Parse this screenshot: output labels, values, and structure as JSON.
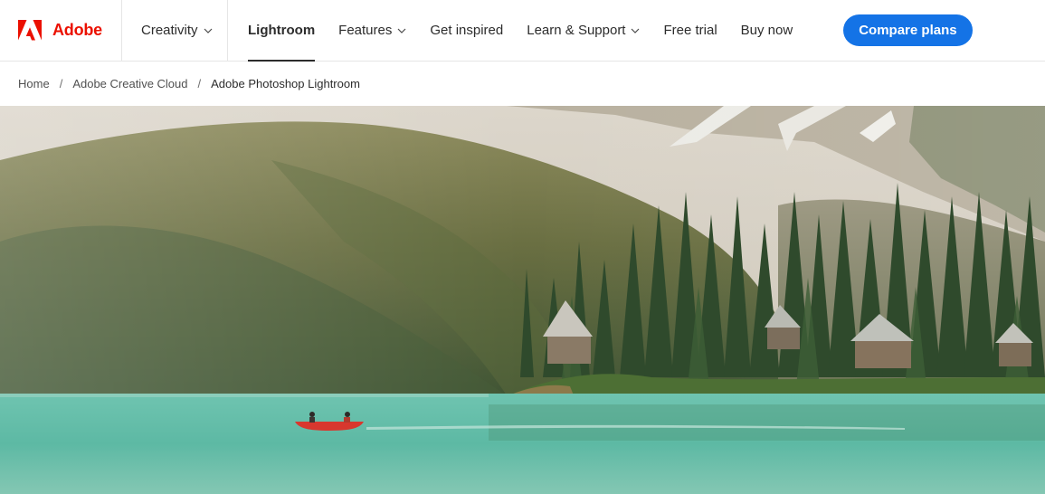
{
  "brand": {
    "name": "Adobe",
    "logo_icon": "adobe-logo-icon",
    "color": "#eb1000"
  },
  "nav": {
    "creativity": {
      "label": "Creativity",
      "icon": "chevron-down-icon"
    },
    "product": "Lightroom",
    "features": {
      "label": "Features",
      "icon": "chevron-down-icon"
    },
    "get_inspired": "Get inspired",
    "learn_support": {
      "label": "Learn & Support",
      "icon": "chevron-down-icon"
    },
    "free_trial": "Free trial",
    "buy_now": "Buy now",
    "cta": {
      "label": "Compare plans",
      "color": "#1473e6"
    }
  },
  "breadcrumb": {
    "items": [
      "Home",
      "Adobe Creative Cloud",
      "Adobe Photoshop Lightroom"
    ],
    "separator": "/"
  },
  "hero": {
    "image": "photo of a turquoise mountain lake with a red canoe carrying two people, forested shoreline with lodges, and snowy mountains behind",
    "colors": {
      "water": "#6fc4b0",
      "forest": "#3e5a34",
      "canoe": "#d8372e"
    }
  }
}
